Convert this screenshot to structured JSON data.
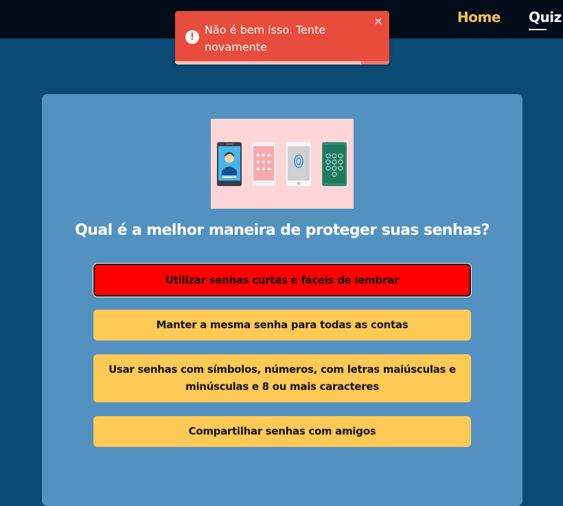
{
  "nav": {
    "home_label": "Home",
    "quiz_label": "Quiz"
  },
  "toast": {
    "icon": "exclamation-icon",
    "icon_glyph": "!",
    "message": "Não é bem isso. Tente novamente",
    "close_glyph": "×",
    "progress": 0.87,
    "color": "#e74c3c"
  },
  "quiz": {
    "image_icon": "smartphone-lock-screens-illustration",
    "question": "Qual é a melhor maneira de proteger suas senhas?",
    "answers": [
      {
        "label": "Utilizar senhas curtas e fáceis de lembrar",
        "state": "wrong"
      },
      {
        "label": "Manter a mesma senha para todas as contas",
        "state": "default"
      },
      {
        "label": "Usar senhas com símbolos, números, com letras maiúsculas e minúsculas e 8 ou mais caracteres",
        "state": "default"
      },
      {
        "label": "Compartilhar senhas com amigos",
        "state": "default"
      }
    ]
  },
  "colors": {
    "background": "#0b4a75",
    "topbar": "#020b18",
    "card": "#5391c0",
    "answer": "#ffc956",
    "answer_wrong": "#ff0000",
    "nav_active": "#f9c34d"
  }
}
